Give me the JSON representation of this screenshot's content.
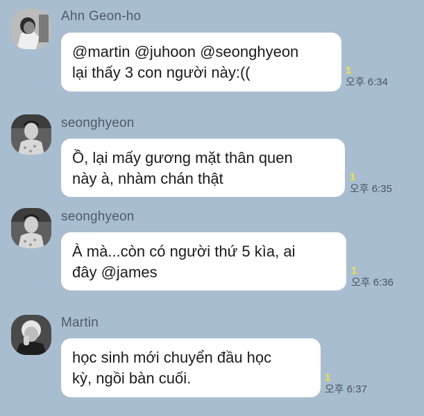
{
  "messages": [
    {
      "sender": "Ahn Geon-ho",
      "avatar": "profile-photo",
      "text": "@martin @juhoon @seonghyeon\nlại thấy 3 con người này:((",
      "unread": "1",
      "time": "오후 6:34"
    },
    {
      "sender": "seonghyeon",
      "avatar": "profile-photo",
      "text": "Ồ, lại mấy gương mặt thân quen\nnày à, nhàm chán thật",
      "unread": "1",
      "time": "오후 6:35"
    },
    {
      "sender": "seonghyeon",
      "avatar": "profile-photo",
      "text": "À mà...còn có người thứ 5 kìa, ai\nđây @james",
      "unread": "1",
      "time": "오후 6:36"
    },
    {
      "sender": "Martin",
      "avatar": "profile-photo",
      "text": "học sinh mới chuyển đầu học\nkỳ, ngồi bàn cuối.",
      "unread": "1",
      "time": "오후 6:37"
    }
  ],
  "colors": {
    "background": "#a9bdd0",
    "bubble": "#ffffff",
    "unread": "#f4e23a",
    "name": "#4f5a66"
  }
}
